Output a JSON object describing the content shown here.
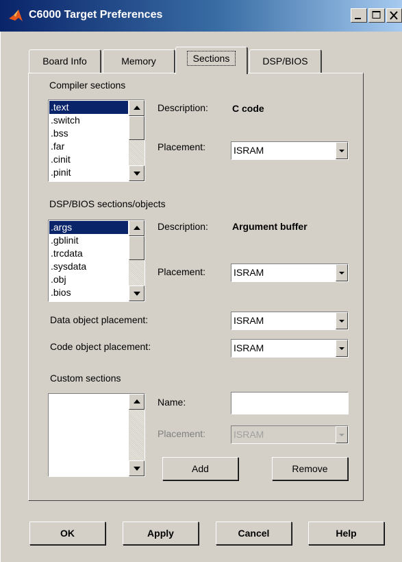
{
  "window": {
    "title": "C6000 Target Preferences",
    "controls": [
      "minimize-icon",
      "maximize-icon",
      "close-icon"
    ]
  },
  "tabs": [
    {
      "label": "Board Info",
      "active": false
    },
    {
      "label": "Memory",
      "active": false
    },
    {
      "label": "Sections",
      "active": true
    },
    {
      "label": "DSP/BIOS",
      "active": false
    }
  ],
  "compiler": {
    "heading": "Compiler sections",
    "items": [
      ".text",
      ".switch",
      ".bss",
      ".far",
      ".cinit",
      ".pinit"
    ],
    "selected": ".text",
    "description_label": "Description:",
    "description_value": "C code",
    "placement_label": "Placement:",
    "placement_value": "ISRAM"
  },
  "dspbios": {
    "heading": "DSP/BIOS sections/objects",
    "items": [
      ".args",
      ".gblinit",
      ".trcdata",
      ".sysdata",
      ".obj",
      ".bios"
    ],
    "selected": ".args",
    "description_label": "Description:",
    "description_value": "Argument buffer",
    "placement_label": "Placement:",
    "placement_value": "ISRAM"
  },
  "data_object": {
    "label": "Data object placement:",
    "value": "ISRAM"
  },
  "code_object": {
    "label": "Code object placement:",
    "value": "ISRAM"
  },
  "custom": {
    "heading": "Custom sections",
    "name_label": "Name:",
    "name_value": "",
    "placement_label": "Placement:",
    "placement_value": "ISRAM",
    "add_label": "Add",
    "remove_label": "Remove"
  },
  "footer": {
    "ok_label": "OK",
    "apply_label": "Apply",
    "cancel_label": "Cancel",
    "help_label": "Help"
  },
  "colors": {
    "title_bar": "#0a246a",
    "selection": "#0a246a",
    "face": "#d4d0c8"
  }
}
